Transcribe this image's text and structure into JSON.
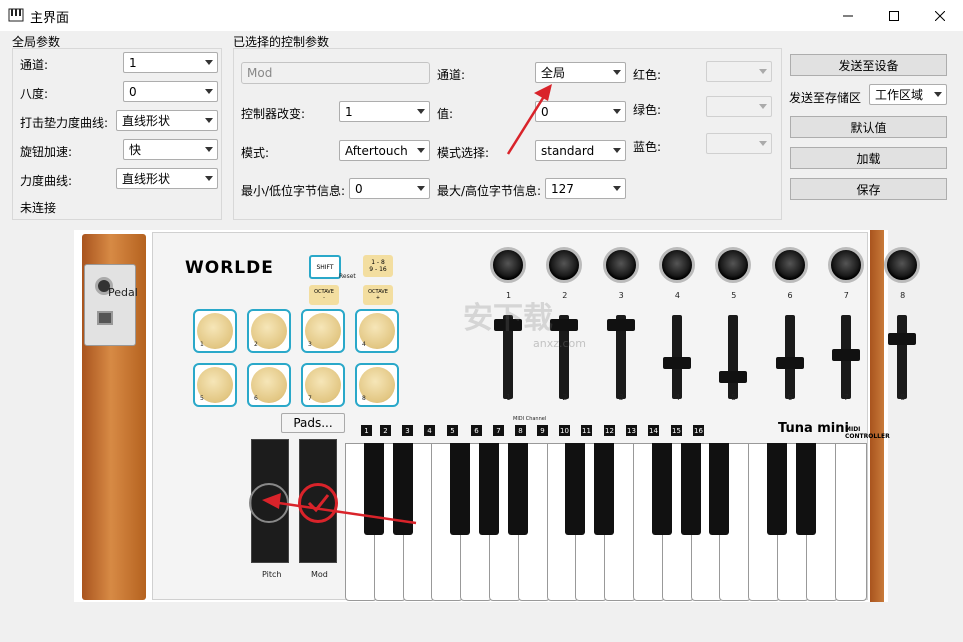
{
  "window": {
    "title": "主界面"
  },
  "global": {
    "group_label": "全局参数",
    "channel_label": "通道:",
    "channel_value": "1",
    "octave_label": "八度:",
    "octave_value": "0",
    "velocity_curve_label": "打击垫力度曲线:",
    "velocity_curve_value": "直线形状",
    "knob_accel_label": "旋钮加速:",
    "knob_accel_value": "快",
    "force_curve_label": "力度曲线:",
    "force_curve_value": "直线形状",
    "status": "未连接"
  },
  "selected": {
    "group_label": "已选择的控制参数",
    "name_value": "Mod",
    "channel_label": "通道:",
    "channel_value": "全局",
    "red_label": "红色:",
    "green_label": "绿色:",
    "blue_label": "蓝色:",
    "cc_label": "控制器改变:",
    "cc_value": "1",
    "value_label": "值:",
    "value_value": "0",
    "mode_label": "模式:",
    "mode_value": "Aftertouch",
    "mode_select_label": "模式选择:",
    "mode_select_value": "standard",
    "min_label": "最小/低位字节信息:",
    "min_value": "0",
    "max_label": "最大/高位字节信息:",
    "max_value": "127"
  },
  "actions": {
    "send_device": "发送至设备",
    "send_storage_label": "发送至存储区",
    "storage_value": "工作区域",
    "default": "默认值",
    "load": "加载",
    "save": "保存"
  },
  "controller": {
    "brand": "WORLDE",
    "pedal": "Pedal",
    "shift": "SHIFT",
    "range": "1 - 8\n9 - 16",
    "reset": "Reset",
    "octave_down": "OCTAVE\n-",
    "octave_up": "OCTAVE\n+",
    "pads_button": "Pads...",
    "midi_channel": "MIDI Channel",
    "model": "Tuna mini",
    "model_sub": "MIDI CONTROLLER",
    "pitch": "Pitch",
    "mod": "Mod",
    "pad_numbers": [
      "1",
      "2",
      "3",
      "4",
      "5",
      "6",
      "7",
      "8"
    ],
    "knob_numbers": [
      "1",
      "2",
      "3",
      "4",
      "5",
      "6",
      "7",
      "8"
    ],
    "fader_numbers": [
      "1",
      "2",
      "3",
      "4",
      "5",
      "6",
      "7",
      "8"
    ],
    "channel_numbers": [
      "1",
      "2",
      "3",
      "4",
      "5",
      "6",
      "7",
      "8",
      "9",
      "10",
      "11",
      "12",
      "13",
      "14",
      "15",
      "16"
    ],
    "watermark": "安下载",
    "watermark_url": "anxz.com"
  },
  "colors": {
    "annotation": "#d9232a",
    "pad_border": "#2aa8c9",
    "wood": "#c8763a"
  }
}
